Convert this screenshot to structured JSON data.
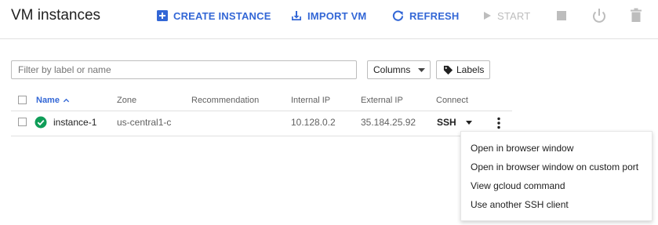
{
  "header": {
    "title": "VM instances",
    "create_instance": "CREATE INSTANCE",
    "import_vm": "IMPORT VM",
    "refresh": "REFRESH",
    "start": "START",
    "icons": [
      "add-box-icon",
      "import-download-icon",
      "refresh-icon",
      "play-icon",
      "stop-icon",
      "power-icon",
      "trash-icon"
    ]
  },
  "filter": {
    "placeholder": "Filter by label or name",
    "value": ""
  },
  "toolbar": {
    "columns_label": "Columns",
    "labels_label": "Labels"
  },
  "table": {
    "columns": [
      "Name",
      "Zone",
      "Recommendation",
      "Internal IP",
      "External IP",
      "Connect"
    ],
    "sorted_column": "Name",
    "sort_direction": "ascending",
    "rows": [
      {
        "status": "running",
        "name": "instance-1",
        "zone": "us-central1-c",
        "recommendation": "",
        "internal_ip": "10.128.0.2",
        "external_ip": "35.184.25.92",
        "connect": "SSH"
      }
    ]
  },
  "ssh_menu": {
    "items": [
      "Open in browser window",
      "Open in browser window on custom port",
      "View gcloud command",
      "Use another SSH client"
    ]
  },
  "colors": {
    "accent": "#3367d6",
    "disabled": "#bdbdbd",
    "status_ok": "#0f9d58",
    "text": "#212121",
    "muted": "#616161"
  }
}
